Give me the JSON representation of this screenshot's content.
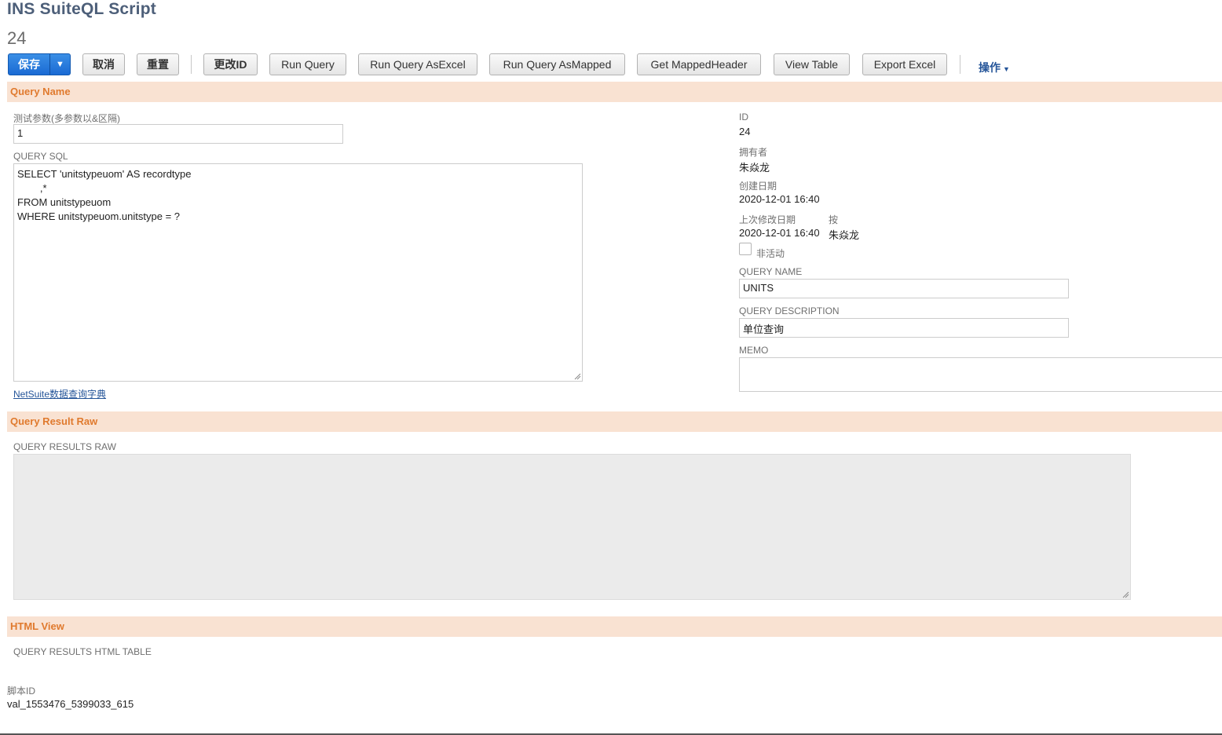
{
  "header": {
    "title": "INS SuiteQL Script",
    "record_number": "24"
  },
  "toolbar": {
    "save_label": "保存",
    "save_menu_caret": "▼",
    "cancel_label": "取消",
    "reset_label": "重置",
    "change_id_label": "更改ID",
    "run_query_label": "Run Query",
    "run_query_excel_label": "Run Query AsExcel",
    "run_query_mapped_label": "Run Query AsMapped",
    "get_mapped_header_label": "Get MappedHeader",
    "view_table_label": "View Table",
    "export_excel_label": "Export Excel",
    "actions_label": "操作",
    "actions_caret": "▼"
  },
  "sections": {
    "query_name": "Query Name",
    "query_result_raw": "Query Result Raw",
    "html_view": "HTML View"
  },
  "left_fields": {
    "test_params_label": "测试参数(多参数以&区隔)",
    "test_params_value": "1",
    "query_sql_label": "QUERY SQL",
    "query_sql_value": "SELECT 'unitstypeuom' AS recordtype\n        ,*\nFROM unitstypeuom\nWHERE unitstypeuom.unitstype = ?",
    "dictionary_link": "NetSuite数据查询字典"
  },
  "right_fields": {
    "id_label": "ID",
    "id_value": "24",
    "owner_label": "拥有者",
    "owner_value": "朱焱龙",
    "created_label": "创建日期",
    "created_value": "2020-12-01 16:40",
    "modified_label": "上次修改日期",
    "modified_value": "2020-12-01 16:40",
    "modified_by_label": "按",
    "modified_by_value": "朱焱龙",
    "inactive_label": "非活动",
    "query_name_label": "QUERY NAME",
    "query_name_value": "UNITS",
    "query_desc_label": "QUERY DESCRIPTION",
    "query_desc_value": "单位查询",
    "memo_label": "MEMO",
    "memo_value": ""
  },
  "raw_section": {
    "results_raw_label": "QUERY RESULTS RAW",
    "results_raw_value": ""
  },
  "html_section": {
    "results_html_label": "QUERY RESULTS HTML TABLE"
  },
  "footer": {
    "script_id_label": "脚本ID",
    "script_id_value": "val_1553476_5399033_615"
  },
  "colors": {
    "section_bg": "#f9e2d2",
    "section_text": "#e07a2e",
    "primary_button": "#1a6ad3",
    "link": "#255599",
    "title": "#4d5f79"
  }
}
